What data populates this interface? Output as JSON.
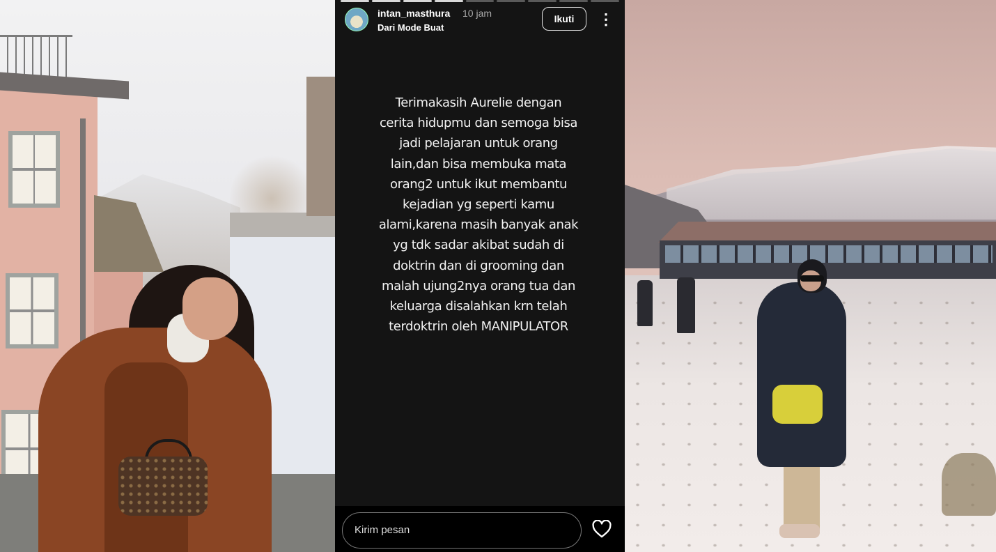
{
  "story": {
    "progress": {
      "total": 9,
      "completed": 4
    },
    "user": {
      "username": "intan_masthura",
      "time_ago": "10 jam",
      "subtitle": "Dari Mode Buat"
    },
    "follow_label": "Ikuti",
    "more_label": "⋮",
    "text_lines": [
      "Terimakasih Aurelie dengan",
      "cerita hidupmu dan semoga bisa",
      "jadi pelajaran untuk orang",
      "lain,dan bisa membuka mata",
      "orang2 untuk ikut membantu",
      "kejadian yg seperti kamu",
      "alami,karena masih banyak anak",
      "yg tdk sadar akibat sudah di",
      "doktrin dan di grooming dan",
      "malah ujung2nya orang tua dan",
      "keluarga disalahkan krn telah",
      "terdoktrin oleh MANIPULATOR"
    ],
    "reply_placeholder": "Kirim pesan",
    "like_icon": "heart-icon",
    "colors": {
      "background": "#141414",
      "bar": "#000000",
      "text": "#f2f2f2"
    }
  }
}
